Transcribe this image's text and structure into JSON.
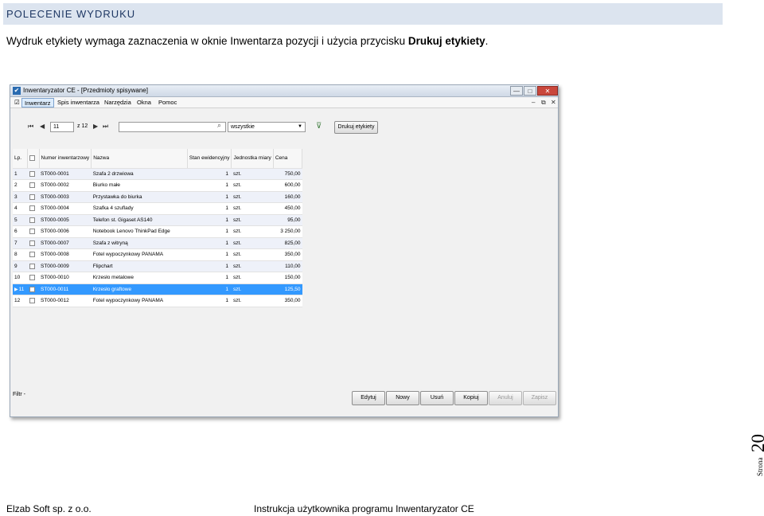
{
  "doc": {
    "section_title": "POLECENIE WYDRUKU",
    "intro_text": "Wydruk etykiety wymaga zaznaczenia w oknie Inwentarza pozycji i użycia przycisku ",
    "intro_bold": "Drukuj etykiety",
    "intro_end": ".",
    "page_number": "20",
    "page_label": "Strona",
    "footer_left": "Elzab Soft sp. z o.o.",
    "footer_right": "Instrukcja użytkownika programu Inwentaryzator CE"
  },
  "window": {
    "title": "Inwentaryzator CE - [Przedmioty spisywane]",
    "controls": {
      "minimize": "—",
      "maximize": "□",
      "close": "✕"
    },
    "mdi_controls": [
      "–",
      "⧉",
      "✕"
    ]
  },
  "menu": [
    "Inwentarz",
    "Spis inwentarza",
    "Narzędzia",
    "Okna",
    "Pomoc"
  ],
  "navigator": {
    "first": "⏮",
    "prev": "◀",
    "page_value": "11",
    "page_of": "z 12",
    "next": "▶",
    "last": "⏭",
    "search_value": "",
    "search_icon": "⌕",
    "filter_select": "wszystkie",
    "print_button": "Drukuj etykiety"
  },
  "grid": {
    "columns": [
      "Lp.",
      "",
      "Numer inwentarzowy",
      "Nazwa",
      "Stan ewidencyjny",
      "Jednostka miary",
      "Cena"
    ],
    "selected_index": 10,
    "rows": [
      [
        "1",
        "ST000-0001",
        "Szafa 2 drzwiowa",
        "1",
        "szt.",
        "750,00"
      ],
      [
        "2",
        "ST000-0002",
        "Biurko małe",
        "1",
        "szt.",
        "600,00"
      ],
      [
        "3",
        "ST000-0003",
        "Przystawka do biurka",
        "1",
        "szt.",
        "160,00"
      ],
      [
        "4",
        "ST000-0004",
        "Szafka 4 szuflady",
        "1",
        "szt.",
        "450,00"
      ],
      [
        "5",
        "ST000-0005",
        "Telefon st. Gigaset AS140",
        "1",
        "szt.",
        "95,00"
      ],
      [
        "6",
        "ST000-0006",
        "Notebook Lenovo ThinkPad Edge",
        "1",
        "szt.",
        "3 250,00"
      ],
      [
        "7",
        "ST000-0007",
        "Szafa z witryną",
        "1",
        "szt.",
        "825,00"
      ],
      [
        "8",
        "ST000-0008",
        "Fotel wypoczynkowy PANAMA",
        "1",
        "szt.",
        "350,00"
      ],
      [
        "9",
        "ST000-0009",
        "Flipchart",
        "1",
        "szt.",
        "110,00"
      ],
      [
        "10",
        "ST000-0010",
        "Krzesło metalowe",
        "1",
        "szt.",
        "150,00"
      ],
      [
        "11",
        "ST000-0011",
        "Krzesło graftowe",
        "1",
        "szt.",
        "125,50"
      ],
      [
        "12",
        "ST000-0012",
        "Fotel wypoczynkowy PANAMA",
        "1",
        "szt.",
        "350,00"
      ]
    ]
  },
  "status": {
    "filter_label": "Filtr -",
    "buttons": [
      {
        "label": "Edytuj",
        "enabled": true
      },
      {
        "label": "Nowy",
        "enabled": true
      },
      {
        "label": "Usuń",
        "enabled": true
      },
      {
        "label": "Kopiuj",
        "enabled": true
      },
      {
        "label": "Anuluj",
        "enabled": false
      },
      {
        "label": "Zapisz",
        "enabled": false
      }
    ]
  },
  "colors": {
    "selection": "#3399ff",
    "header_band": "#dce4ef"
  }
}
